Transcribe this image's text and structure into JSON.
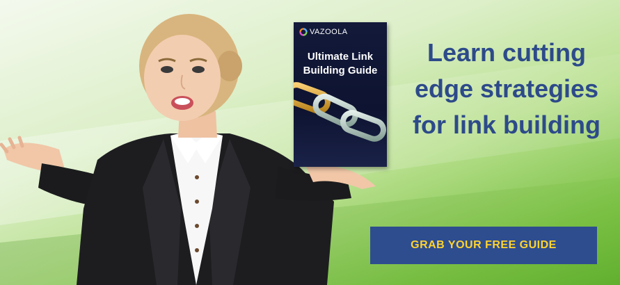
{
  "book": {
    "brand": "VAZOOLA",
    "title_line1": "Ultimate Link",
    "title_line2": "Building Guide",
    "logo_icon": "vazoola-ring-icon",
    "cover_icon": "chain-links-icon"
  },
  "headline": {
    "line1": "Learn cutting",
    "line2": "edge strategies",
    "line3": "for link building"
  },
  "cta": {
    "label": "GRAB YOUR FREE GUIDE"
  },
  "colors": {
    "headline": "#2d4a8a",
    "cta_background": "#2e4d8f",
    "cta_text": "#ffd32f",
    "green": "#5fae2e"
  }
}
